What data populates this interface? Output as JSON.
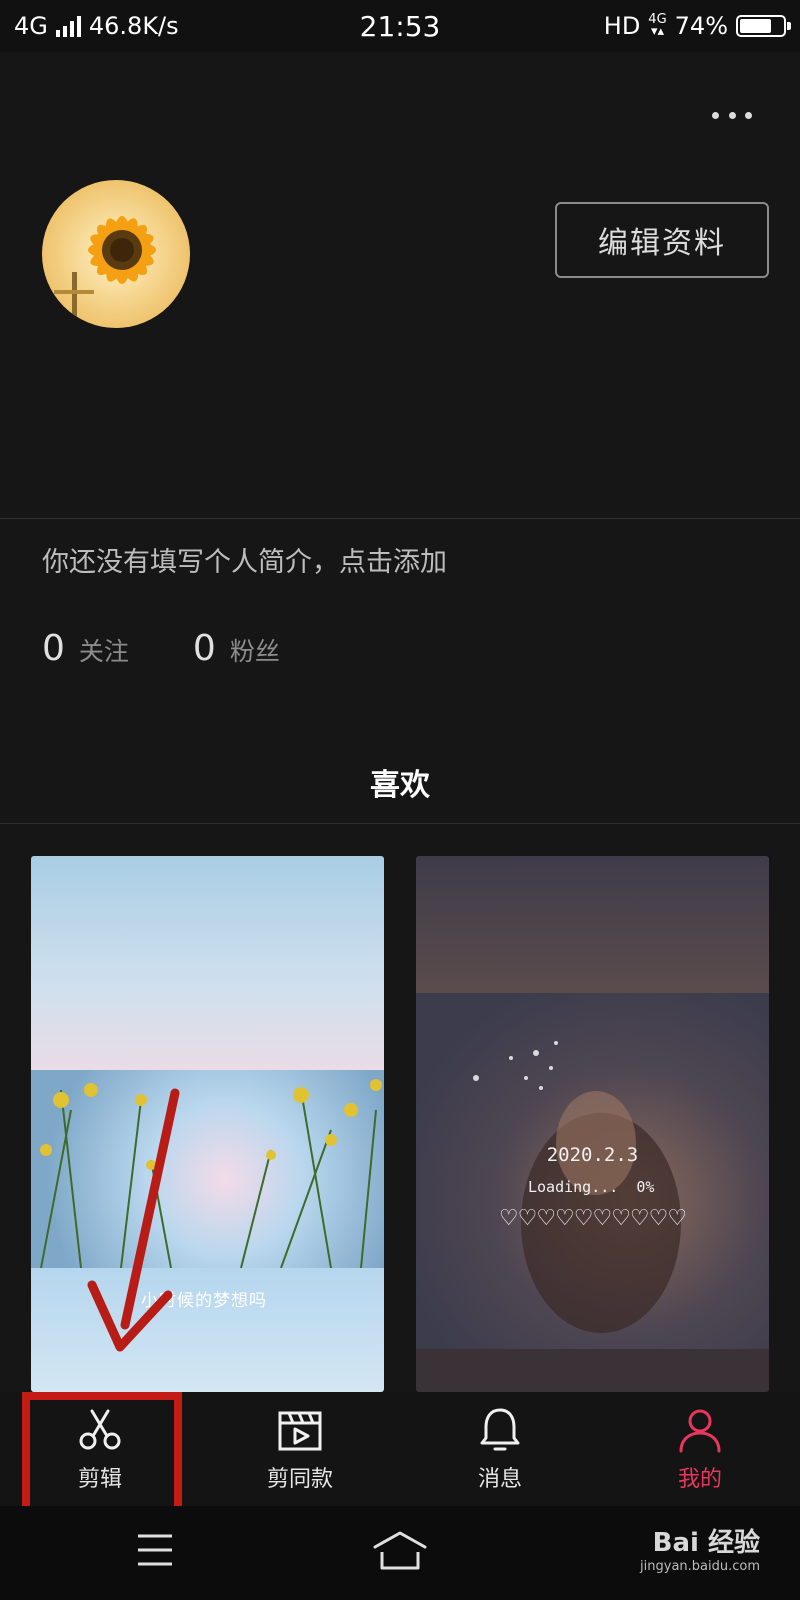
{
  "status_bar": {
    "network": "4G",
    "speed": "46.8K/s",
    "time": "21:53",
    "hd": "HD",
    "net_small": "4G",
    "battery": "74%",
    "battery_level": 0.74
  },
  "profile": {
    "edit_label": "编辑资料",
    "bio": "你还没有填写个人简介，点击添加",
    "following_count": "0",
    "following_label": "关注",
    "followers_count": "0",
    "followers_label": "粉丝"
  },
  "tabs": {
    "liked": "喜欢"
  },
  "cards": [
    {
      "caption": "小时候的梦想吗"
    },
    {
      "date": "2020.2.3",
      "loading": "Loading...  0%",
      "hearts": "♡♡♡♡♡♡♡♡♡♡"
    }
  ],
  "bottom_nav": [
    {
      "label": "剪辑",
      "icon": "scissors-icon"
    },
    {
      "label": "剪同款",
      "icon": "clapperboard-icon"
    },
    {
      "label": "消息",
      "icon": "bell-icon"
    },
    {
      "label": "我的",
      "icon": "user-icon",
      "active": true
    }
  ],
  "watermark": {
    "main": "Bai 经验",
    "url": "jingyan.baidu.com"
  },
  "colors": {
    "background": "#161616",
    "accent": "#e8365d",
    "annotation": "#c41b14"
  }
}
